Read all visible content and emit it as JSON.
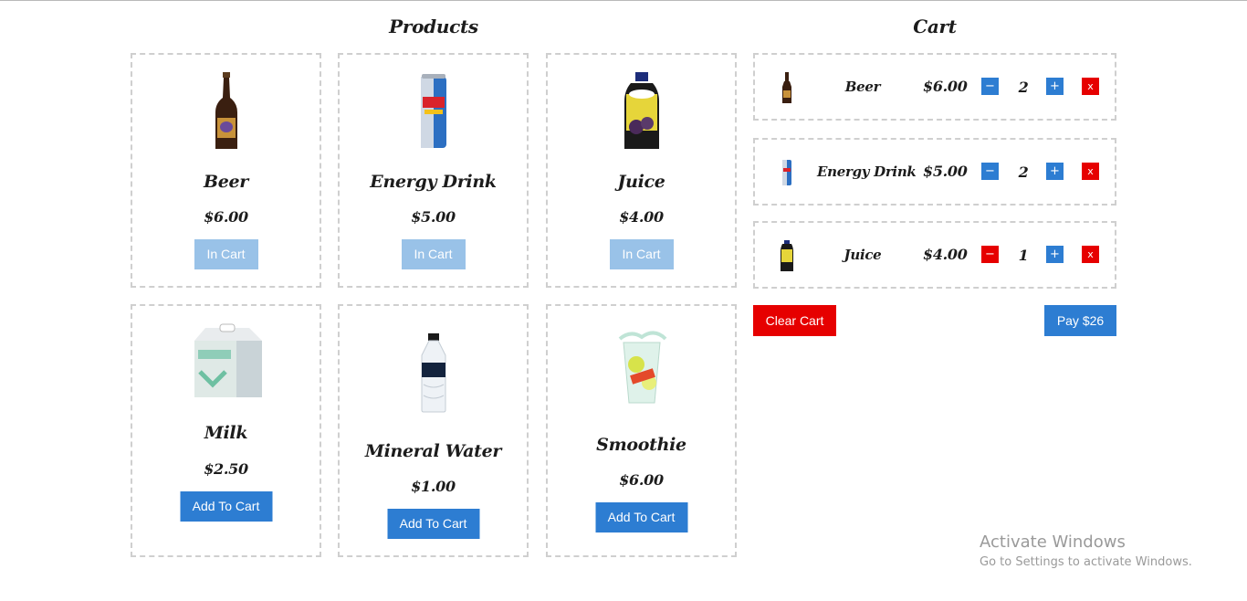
{
  "products_title": "Products",
  "cart_title": "Cart",
  "products": [
    {
      "name": "Beer",
      "price": "$6.00",
      "button": "In Cart",
      "icon": "beer-bottle-image"
    },
    {
      "name": "Energy Drink",
      "price": "$5.00",
      "button": "In Cart",
      "icon": "energy-drink-can-image"
    },
    {
      "name": "Juice",
      "price": "$4.00",
      "button": "In Cart",
      "icon": "juice-bottle-image"
    },
    {
      "name": "Milk",
      "price": "$2.50",
      "button": "Add To Cart",
      "icon": "milk-box-image"
    },
    {
      "name": "Mineral Water",
      "price": "$1.00",
      "button": "Add To Cart",
      "icon": "water-bottle-image"
    },
    {
      "name": "Smoothie",
      "price": "$6.00",
      "button": "Add To Cart",
      "icon": "smoothie-cup-image"
    }
  ],
  "cart": {
    "items": [
      {
        "name": "Beer",
        "price": "$6.00",
        "qty": "2",
        "minus": "−",
        "plus": "+",
        "remove": "x"
      },
      {
        "name": "Energy Drink",
        "price": "$5.00",
        "qty": "2",
        "minus": "−",
        "plus": "+",
        "remove": "x"
      },
      {
        "name": "Juice",
        "price": "$4.00",
        "qty": "1",
        "minus": "−",
        "plus": "+",
        "remove": "x"
      }
    ],
    "clear_label": "Clear Cart",
    "pay_label": "Pay $26"
  },
  "watermark": {
    "line1": "Activate Windows",
    "line2": "Go to Settings to activate Windows."
  },
  "colors": {
    "primary": "#2d7dd2",
    "primary_disabled": "#99c2e8",
    "danger": "#e60000"
  }
}
